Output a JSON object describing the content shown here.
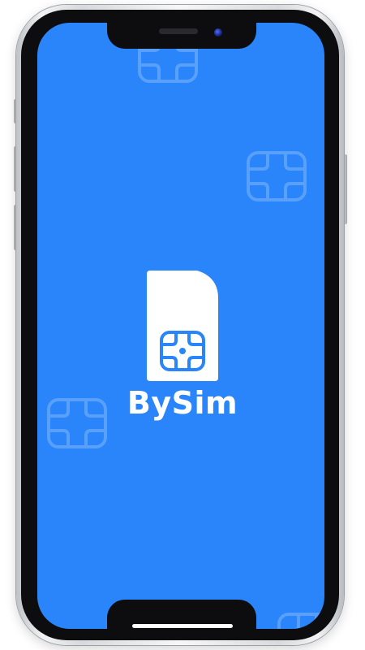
{
  "app": {
    "brand_name": "BySim"
  },
  "theme": {
    "screen_background": "#2a85fb",
    "logo_color": "#ffffff",
    "chip_color": "#2a85fb"
  },
  "icons": {
    "logo": "sim-card-icon",
    "watermark": "sim-chip-icon"
  }
}
